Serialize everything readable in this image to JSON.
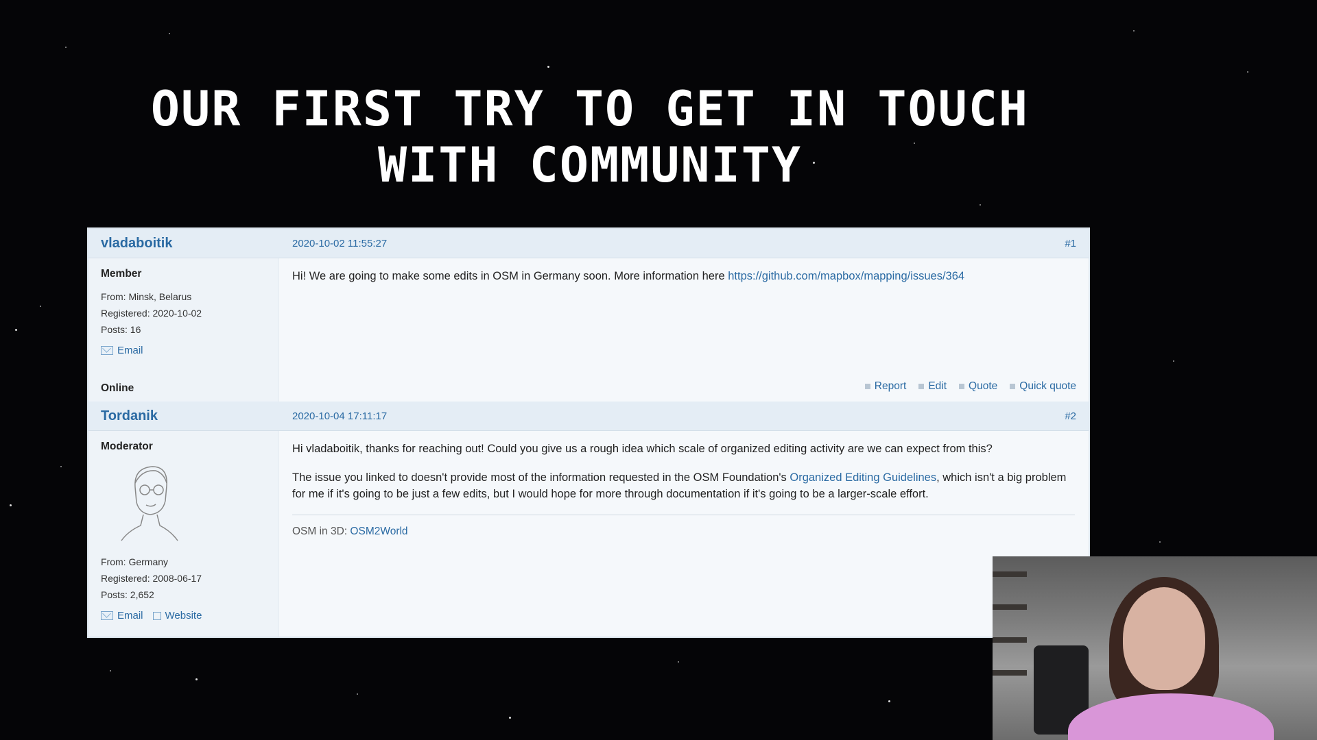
{
  "slide": {
    "title": "OUR FIRST TRY TO GET IN TOUCH WITH COMMUNITY"
  },
  "posts": [
    {
      "author": "vladaboitik",
      "date": "2020-10-02 11:55:27",
      "number": "#1",
      "role": "Member",
      "from": "From: Minsk, Belarus",
      "registered": "Registered: 2020-10-02",
      "posts": "Posts: 16",
      "email_label": "Email",
      "status": "Online",
      "message_text": "Hi! We are going to make some edits in OSM in Germany soon. More information here ",
      "message_link": "https://github.com/mapbox/mapping/issues/364",
      "actions": [
        "Report",
        "Edit",
        "Quote",
        "Quick quote"
      ]
    },
    {
      "author": "Tordanik",
      "date": "2020-10-04 17:11:17",
      "number": "#2",
      "role": "Moderator",
      "from": "From: Germany",
      "registered": "Registered: 2008-06-17",
      "posts": "Posts: 2,652",
      "email_label": "Email",
      "website_label": "Website",
      "paragraph1": "Hi vladaboitik, thanks for reaching out! Could you give us a rough idea which scale of organized editing activity are we can expect from this?",
      "paragraph2_before": "The issue you linked to doesn't provide most of the information requested in the OSM Foundation's ",
      "paragraph2_link": "Organized Editing Guidelines",
      "paragraph2_after": ", which isn't a big problem for me if it's going to be just a few edits, but I would hope for more through documentation if it's going to be a larger-scale effort.",
      "signature_text": "OSM in 3D: ",
      "signature_link": "OSM2World"
    }
  ],
  "icons": {
    "email": "envelope-icon",
    "website": "external-link-icon",
    "action": "bullet-icon"
  },
  "colors": {
    "background": "#050507",
    "link": "#2a6aa3",
    "post_header": "#e4edf5",
    "post_body": "#f5f8fb"
  }
}
